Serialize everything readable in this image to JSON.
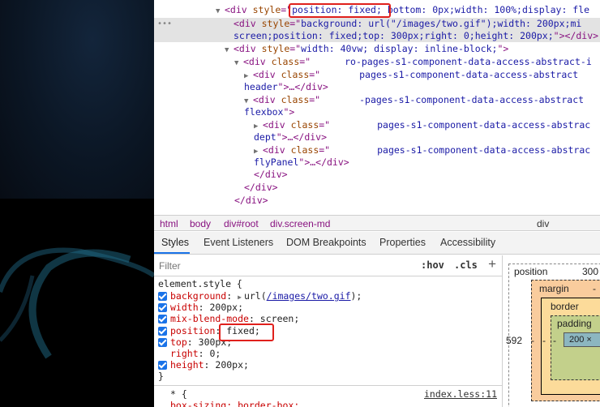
{
  "elements_tree": {
    "line1": {
      "open": "<div ",
      "attr": "style",
      "eq": "=\"",
      "val1": "position: fixed;",
      "val2": " bottom: 0px;width: 100%;display: fle"
    },
    "line2": {
      "open": "<div ",
      "attr": "style",
      "eq": "=\"",
      "val": "background: url(\"/images/two.gif\");width: 200px;mi"
    },
    "line3": {
      "val": "screen;position: fixed;top: 300px;right: 0;height: 200px;",
      "close": "\"></div>"
    },
    "line4": {
      "open": "<div ",
      "attr": "style",
      "eq": "=\"",
      "val": "width: 40vw; display: inline-block;",
      "close": "\">"
    },
    "line5": {
      "open": "<div ",
      "attr": "class",
      "eq": "=\"",
      "val": "ro-pages-s1-component-data-access-abstract-i"
    },
    "line6": {
      "open": "<div ",
      "attr": "class",
      "eq": "=\"",
      "val": "pages-s1-component-data-access-abstract"
    },
    "line7": {
      "val": "header",
      "close": "\">…</div>"
    },
    "line8": {
      "open": "<div ",
      "attr": "class",
      "eq": "=\"",
      "val": "-pages-s1-component-data-access-abstract"
    },
    "line9": {
      "val": "flexbox",
      "close": "\">"
    },
    "line10": {
      "open": "<div ",
      "attr": "class",
      "eq": "=\"",
      "val": "pages-s1-component-data-access-abstrac"
    },
    "line11": {
      "val": "dept",
      "close": "\">…</div>"
    },
    "line12": {
      "open": "<div ",
      "attr": "class",
      "eq": "=\"",
      "val": "pages-s1-component-data-access-abstrac"
    },
    "line13": {
      "val": "flyPanel",
      "close": "\">…</div>"
    },
    "line14": {
      "close": "</div>"
    },
    "line15": {
      "close": "</div>"
    },
    "line16": {
      "close": "</div>"
    }
  },
  "breadcrumb": {
    "html": "html",
    "body": "body",
    "root": "div#root",
    "screen": "div.screen-md",
    "tail": "div"
  },
  "tabs": [
    "Styles",
    "Event Listeners",
    "DOM Breakpoints",
    "Properties",
    "Accessibility"
  ],
  "styles": {
    "filter_placeholder": "Filter",
    "hov": ":hov",
    "cls": ".cls",
    "plus": "+",
    "selector": "element.style {",
    "props": [
      {
        "name": "background",
        "value_prefix": "url(",
        "link": "/images/two.gif",
        "value_suffix": ");"
      },
      {
        "name": "width",
        "value": "200px;"
      },
      {
        "name": "mix-blend-mode",
        "value": "screen;"
      },
      {
        "name": "position",
        "value": "fixed;"
      },
      {
        "name": "top",
        "value": "300px;"
      },
      {
        "name": "right",
        "value": "0;"
      },
      {
        "name": "height",
        "value": "200px;"
      }
    ],
    "close_brace": "}",
    "next_selector": "* {",
    "next_source": "index.less:11",
    "next_prop": "box-sizing: border-box;"
  },
  "box_model": {
    "position_label": "position",
    "position_value": "300",
    "margin_label": "margin",
    "border_label": "border",
    "padding_label": "padding",
    "content": "200 ×",
    "left_value": "592",
    "dash": "-",
    "margin_dash": "-",
    "bottom_value": "?"
  }
}
